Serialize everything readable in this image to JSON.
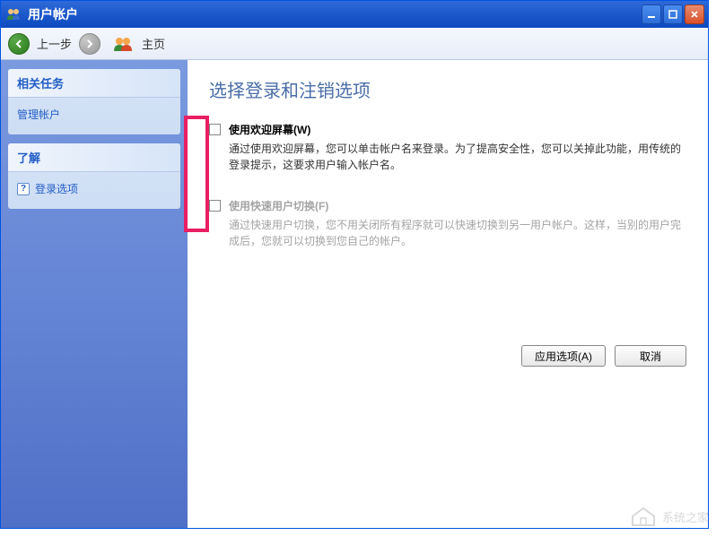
{
  "window": {
    "title": "用户帐户"
  },
  "toolbar": {
    "back_label": "上一步",
    "home_label": "主页"
  },
  "sidebar": {
    "related": {
      "header": "相关任务",
      "links": [
        {
          "label": "管理帐户"
        }
      ]
    },
    "learn": {
      "header": "了解",
      "links": [
        {
          "label": "登录选项"
        }
      ]
    }
  },
  "content": {
    "title": "选择登录和注销选项",
    "options": [
      {
        "title": "使用欢迎屏幕(W)",
        "desc": "通过使用欢迎屏幕，您可以单击帐户名来登录。为了提高安全性，您可以关掉此功能，用传统的登录提示，这要求用户输入帐户名。",
        "disabled": false
      },
      {
        "title": "使用快速用户切换(F)",
        "desc": "通过快速用户切换，您不用关闭所有程序就可以快速切换到另一用户帐户。这样，当别的用户完成后，您就可以切换到您自己的帐户。",
        "disabled": true
      }
    ],
    "buttons": {
      "apply": "应用选项(A)",
      "cancel": "取消"
    }
  },
  "watermark": "系统之家"
}
